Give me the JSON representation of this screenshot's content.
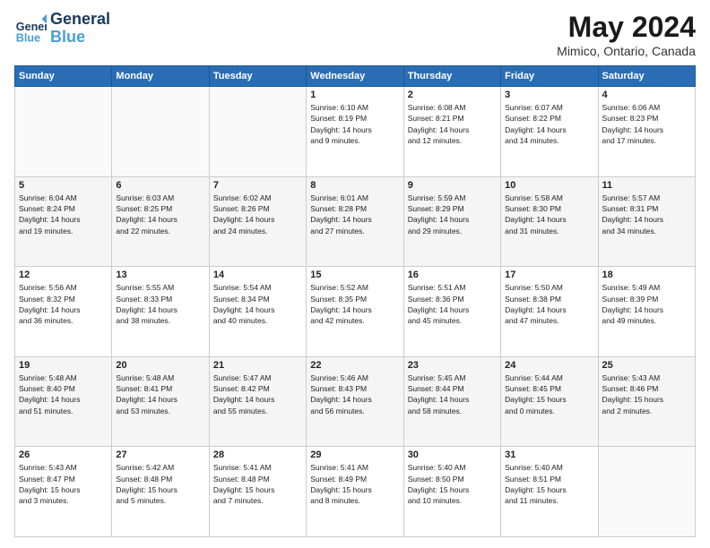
{
  "header": {
    "logo_line1": "General",
    "logo_line2": "Blue",
    "month_year": "May 2024",
    "location": "Mimico, Ontario, Canada"
  },
  "weekdays": [
    "Sunday",
    "Monday",
    "Tuesday",
    "Wednesday",
    "Thursday",
    "Friday",
    "Saturday"
  ],
  "weeks": [
    [
      {
        "day": "",
        "info": ""
      },
      {
        "day": "",
        "info": ""
      },
      {
        "day": "",
        "info": ""
      },
      {
        "day": "1",
        "info": "Sunrise: 6:10 AM\nSunset: 8:19 PM\nDaylight: 14 hours\nand 9 minutes."
      },
      {
        "day": "2",
        "info": "Sunrise: 6:08 AM\nSunset: 8:21 PM\nDaylight: 14 hours\nand 12 minutes."
      },
      {
        "day": "3",
        "info": "Sunrise: 6:07 AM\nSunset: 8:22 PM\nDaylight: 14 hours\nand 14 minutes."
      },
      {
        "day": "4",
        "info": "Sunrise: 6:06 AM\nSunset: 8:23 PM\nDaylight: 14 hours\nand 17 minutes."
      }
    ],
    [
      {
        "day": "5",
        "info": "Sunrise: 6:04 AM\nSunset: 8:24 PM\nDaylight: 14 hours\nand 19 minutes."
      },
      {
        "day": "6",
        "info": "Sunrise: 6:03 AM\nSunset: 8:25 PM\nDaylight: 14 hours\nand 22 minutes."
      },
      {
        "day": "7",
        "info": "Sunrise: 6:02 AM\nSunset: 8:26 PM\nDaylight: 14 hours\nand 24 minutes."
      },
      {
        "day": "8",
        "info": "Sunrise: 6:01 AM\nSunset: 8:28 PM\nDaylight: 14 hours\nand 27 minutes."
      },
      {
        "day": "9",
        "info": "Sunrise: 5:59 AM\nSunset: 8:29 PM\nDaylight: 14 hours\nand 29 minutes."
      },
      {
        "day": "10",
        "info": "Sunrise: 5:58 AM\nSunset: 8:30 PM\nDaylight: 14 hours\nand 31 minutes."
      },
      {
        "day": "11",
        "info": "Sunrise: 5:57 AM\nSunset: 8:31 PM\nDaylight: 14 hours\nand 34 minutes."
      }
    ],
    [
      {
        "day": "12",
        "info": "Sunrise: 5:56 AM\nSunset: 8:32 PM\nDaylight: 14 hours\nand 36 minutes."
      },
      {
        "day": "13",
        "info": "Sunrise: 5:55 AM\nSunset: 8:33 PM\nDaylight: 14 hours\nand 38 minutes."
      },
      {
        "day": "14",
        "info": "Sunrise: 5:54 AM\nSunset: 8:34 PM\nDaylight: 14 hours\nand 40 minutes."
      },
      {
        "day": "15",
        "info": "Sunrise: 5:52 AM\nSunset: 8:35 PM\nDaylight: 14 hours\nand 42 minutes."
      },
      {
        "day": "16",
        "info": "Sunrise: 5:51 AM\nSunset: 8:36 PM\nDaylight: 14 hours\nand 45 minutes."
      },
      {
        "day": "17",
        "info": "Sunrise: 5:50 AM\nSunset: 8:38 PM\nDaylight: 14 hours\nand 47 minutes."
      },
      {
        "day": "18",
        "info": "Sunrise: 5:49 AM\nSunset: 8:39 PM\nDaylight: 14 hours\nand 49 minutes."
      }
    ],
    [
      {
        "day": "19",
        "info": "Sunrise: 5:48 AM\nSunset: 8:40 PM\nDaylight: 14 hours\nand 51 minutes."
      },
      {
        "day": "20",
        "info": "Sunrise: 5:48 AM\nSunset: 8:41 PM\nDaylight: 14 hours\nand 53 minutes."
      },
      {
        "day": "21",
        "info": "Sunrise: 5:47 AM\nSunset: 8:42 PM\nDaylight: 14 hours\nand 55 minutes."
      },
      {
        "day": "22",
        "info": "Sunrise: 5:46 AM\nSunset: 8:43 PM\nDaylight: 14 hours\nand 56 minutes."
      },
      {
        "day": "23",
        "info": "Sunrise: 5:45 AM\nSunset: 8:44 PM\nDaylight: 14 hours\nand 58 minutes."
      },
      {
        "day": "24",
        "info": "Sunrise: 5:44 AM\nSunset: 8:45 PM\nDaylight: 15 hours\nand 0 minutes."
      },
      {
        "day": "25",
        "info": "Sunrise: 5:43 AM\nSunset: 8:46 PM\nDaylight: 15 hours\nand 2 minutes."
      }
    ],
    [
      {
        "day": "26",
        "info": "Sunrise: 5:43 AM\nSunset: 8:47 PM\nDaylight: 15 hours\nand 3 minutes."
      },
      {
        "day": "27",
        "info": "Sunrise: 5:42 AM\nSunset: 8:48 PM\nDaylight: 15 hours\nand 5 minutes."
      },
      {
        "day": "28",
        "info": "Sunrise: 5:41 AM\nSunset: 8:48 PM\nDaylight: 15 hours\nand 7 minutes."
      },
      {
        "day": "29",
        "info": "Sunrise: 5:41 AM\nSunset: 8:49 PM\nDaylight: 15 hours\nand 8 minutes."
      },
      {
        "day": "30",
        "info": "Sunrise: 5:40 AM\nSunset: 8:50 PM\nDaylight: 15 hours\nand 10 minutes."
      },
      {
        "day": "31",
        "info": "Sunrise: 5:40 AM\nSunset: 8:51 PM\nDaylight: 15 hours\nand 11 minutes."
      },
      {
        "day": "",
        "info": ""
      }
    ]
  ]
}
